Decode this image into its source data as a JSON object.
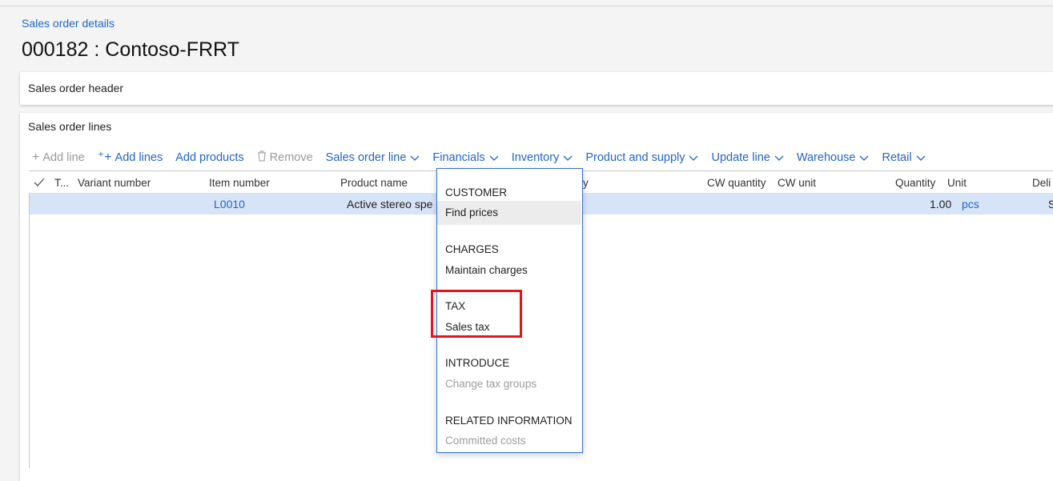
{
  "breadcrumb": "Sales order details",
  "page_title": "000182 : Contoso-FRRT",
  "header_section": {
    "label": "Sales order header"
  },
  "lines_section": {
    "label": "Sales order lines"
  },
  "toolbar": {
    "add_line": "Add line",
    "add_lines": "Add lines",
    "add_products": "Add products",
    "remove": "Remove",
    "sales_order_line": "Sales order line",
    "financials": "Financials",
    "inventory": "Inventory",
    "product_and_supply": "Product and supply",
    "update_line": "Update line",
    "warehouse": "Warehouse",
    "retail": "Retail"
  },
  "grid": {
    "columns": {
      "type": "T...",
      "variant_number": "Variant number",
      "item_number": "Item number",
      "product_name": "Product name",
      "category": "y",
      "cw_quantity": "CW quantity",
      "cw_unit": "CW unit",
      "quantity": "Quantity",
      "unit": "Unit",
      "delivery": "Deli"
    },
    "rows": [
      {
        "item_number": "L0010",
        "product_name": "Active stereo spe",
        "quantity": "1.00",
        "unit": "pcs",
        "delivery": "S"
      }
    ]
  },
  "financials_menu": {
    "customer_header": "CUSTOMER",
    "find_prices": "Find prices",
    "charges_header": "CHARGES",
    "maintain_charges": "Maintain charges",
    "tax_header": "TAX",
    "sales_tax": "Sales tax",
    "introduce_header": "INTRODUCE",
    "change_tax_groups": "Change tax groups",
    "related_header": "RELATED INFORMATION",
    "committed_costs": "Committed costs"
  },
  "highlight_color": "#e3141c",
  "accent_color": "#2266c4"
}
